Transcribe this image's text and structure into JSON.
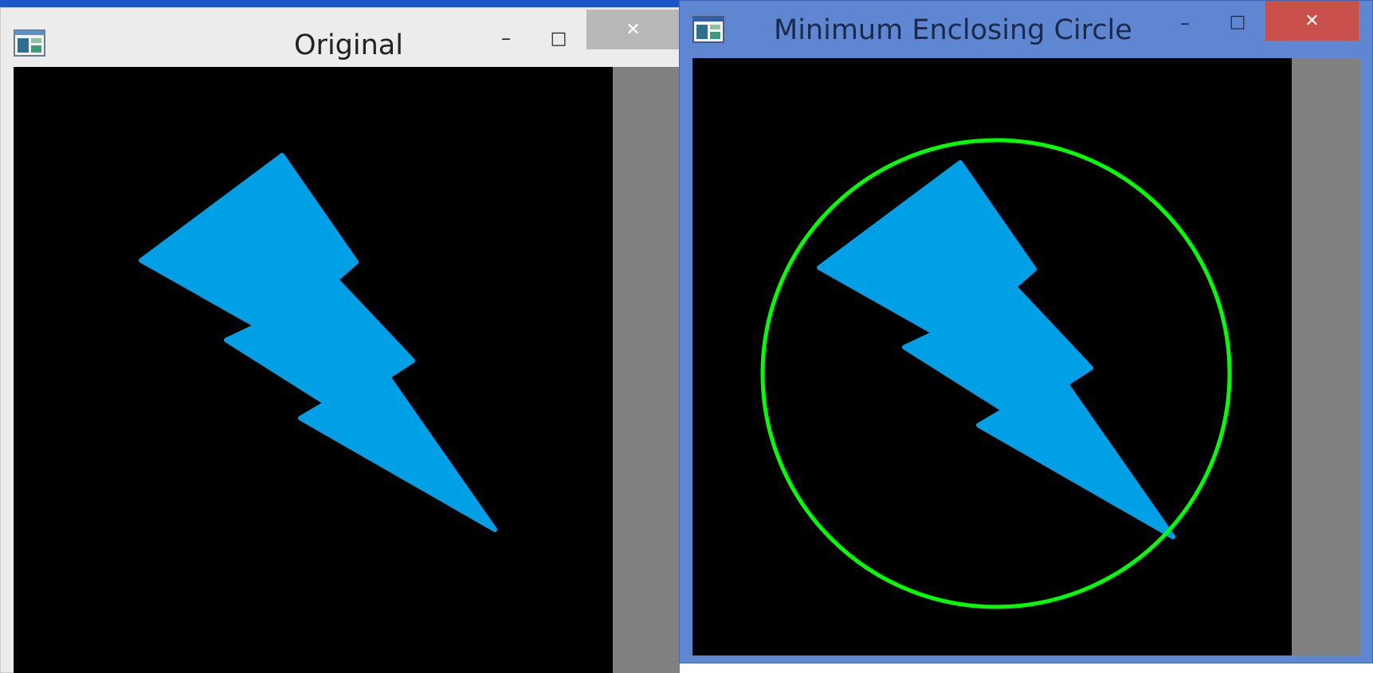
{
  "windows": {
    "original": {
      "title": "Original",
      "icon": "app-window-icon",
      "buttons": {
        "minimize": "–",
        "maximize": "□",
        "close": "✕"
      },
      "state": "inactive"
    },
    "mec": {
      "title": "Minimum Enclosing Circle",
      "icon": "app-window-icon",
      "buttons": {
        "minimize": "–",
        "maximize": "□",
        "close": "✕"
      },
      "state": "active"
    }
  },
  "colors": {
    "shape_fill": "#00a0e6",
    "circle_stroke": "#00ff00",
    "image_background": "#000000",
    "client_background": "#808080",
    "active_titlebar": "#5f86d0",
    "close_active": "#c9504b",
    "close_inactive": "#b8b8b8"
  },
  "content": {
    "shape": "lightning-bolt",
    "overlay": "minimum-enclosing-circle"
  }
}
